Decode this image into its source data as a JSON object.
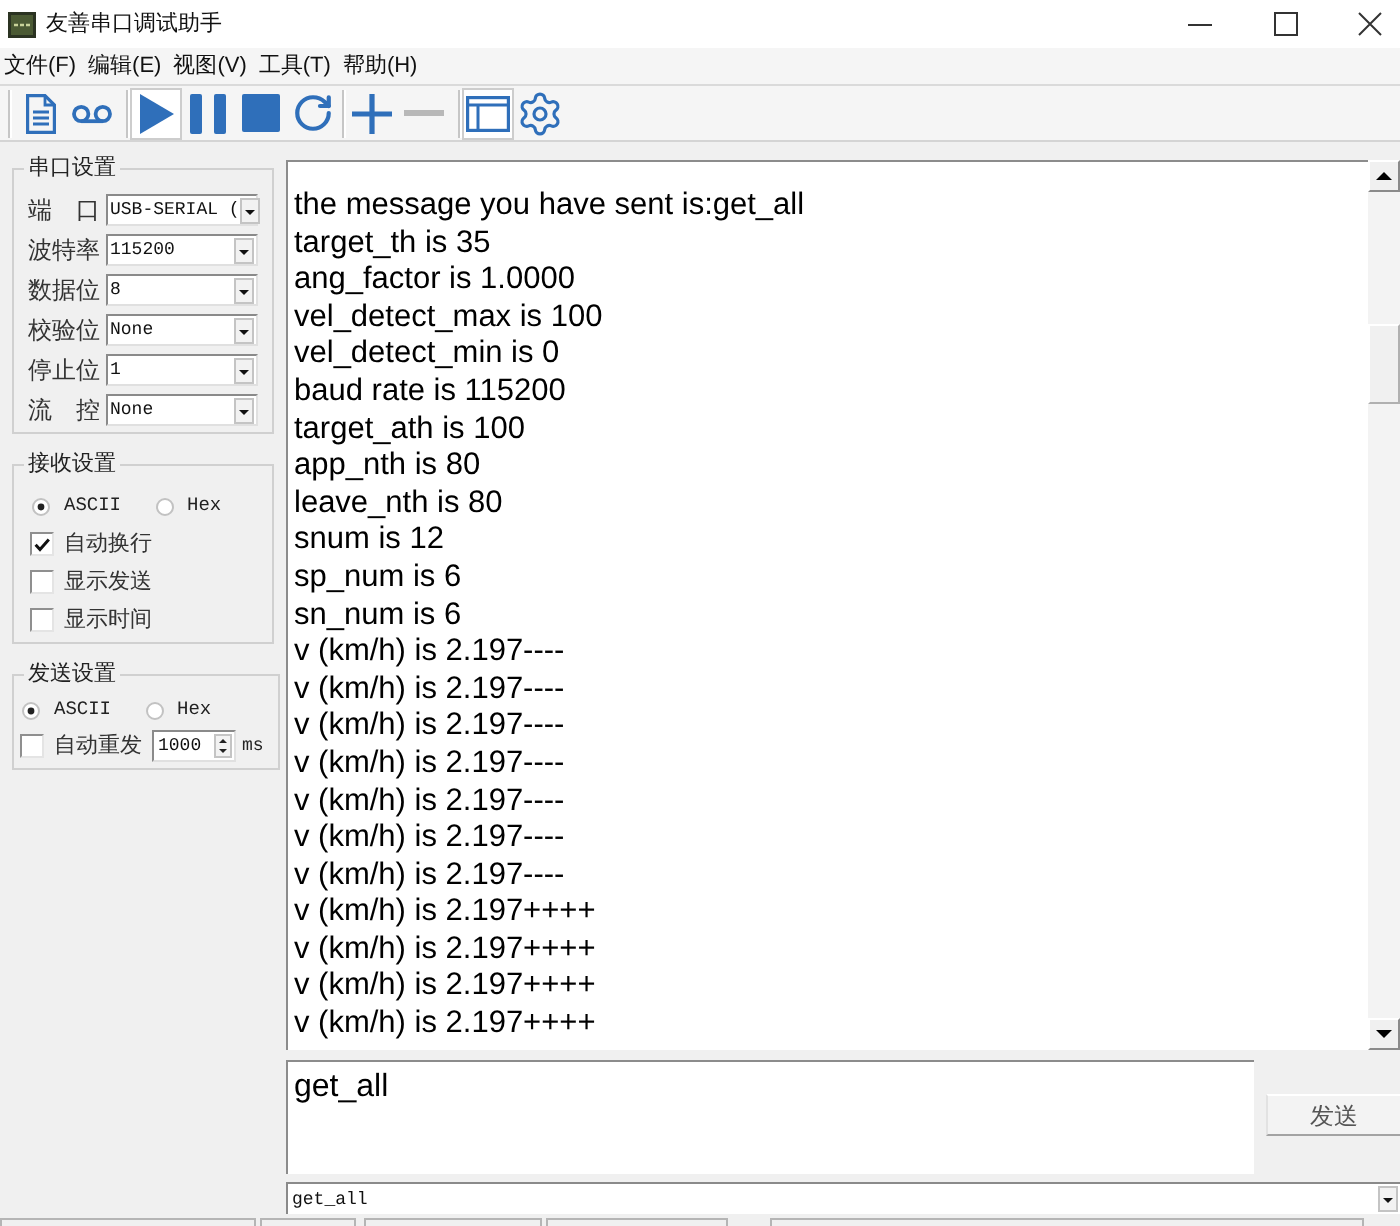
{
  "window": {
    "title": "友善串口调试助手"
  },
  "menu": [
    "文件(F)",
    "编辑(E)",
    "视图(V)",
    "工具(T)",
    "帮助(H)"
  ],
  "toolbar": {
    "groups": [
      [
        {
          "kind": "document",
          "selected": false,
          "disabled": false
        },
        {
          "kind": "voicemail",
          "selected": false,
          "disabled": false
        }
      ],
      [
        {
          "kind": "play",
          "selected": true,
          "disabled": false
        },
        {
          "kind": "pause",
          "selected": false,
          "disabled": false
        },
        {
          "kind": "stop",
          "selected": false,
          "disabled": false
        },
        {
          "kind": "refresh",
          "selected": false,
          "disabled": false
        }
      ],
      [
        {
          "kind": "plus",
          "selected": false,
          "disabled": false
        },
        {
          "kind": "minus",
          "selected": false,
          "disabled": true
        }
      ],
      [
        {
          "kind": "window",
          "selected": true,
          "disabled": false
        },
        {
          "kind": "gear",
          "selected": false,
          "disabled": false
        }
      ]
    ]
  },
  "serial_settings": {
    "title": "串口设置",
    "fields": [
      {
        "label": "端　口",
        "value": "USB-SERIAL ("
      },
      {
        "label": "波特率",
        "value": "115200"
      },
      {
        "label": "数据位",
        "value": "8"
      },
      {
        "label": "校验位",
        "value": "None"
      },
      {
        "label": "停止位",
        "value": "1"
      },
      {
        "label": "流　控",
        "value": "None"
      }
    ]
  },
  "receive_settings": {
    "title": "接收设置",
    "modes": [
      {
        "label": "ASCII",
        "selected": true
      },
      {
        "label": "Hex",
        "selected": false
      }
    ],
    "options": [
      {
        "label": "自动换行",
        "checked": true
      },
      {
        "label": "显示发送",
        "checked": false
      },
      {
        "label": "显示时间",
        "checked": false
      }
    ]
  },
  "send_settings": {
    "title": "发送设置",
    "modes": [
      {
        "label": "ASCII",
        "selected": true
      },
      {
        "label": "Hex",
        "selected": false
      }
    ],
    "auto_resend": {
      "label": "自动重发",
      "checked": false,
      "interval": "1000",
      "unit": "ms"
    }
  },
  "receive_log": {
    "lines": [
      "the message you have sent is:get_all",
      "target_th is 35",
      "ang_factor is 1.0000",
      "vel_detect_max is 100",
      "vel_detect_min is 0",
      "baud rate is 115200",
      "target_ath is 100",
      "app_nth is 80",
      "leave_nth is 80",
      "snum is 12",
      "sp_num is 6",
      "sn_num is 6",
      "v (km/h) is 2.197----",
      "v (km/h) is 2.197----",
      "v (km/h) is 2.197----",
      "v (km/h) is 2.197----",
      "v (km/h) is 2.197----",
      "v (km/h) is 2.197----",
      "v (km/h) is 2.197----",
      "v (km/h) is 2.197++++",
      "v (km/h) is 2.197++++",
      "v (km/h) is 2.197++++",
      "v (km/h) is 2.197++++"
    ]
  },
  "send_area": {
    "value": "get_all",
    "button": "发送"
  },
  "history": {
    "value": "get_all"
  }
}
